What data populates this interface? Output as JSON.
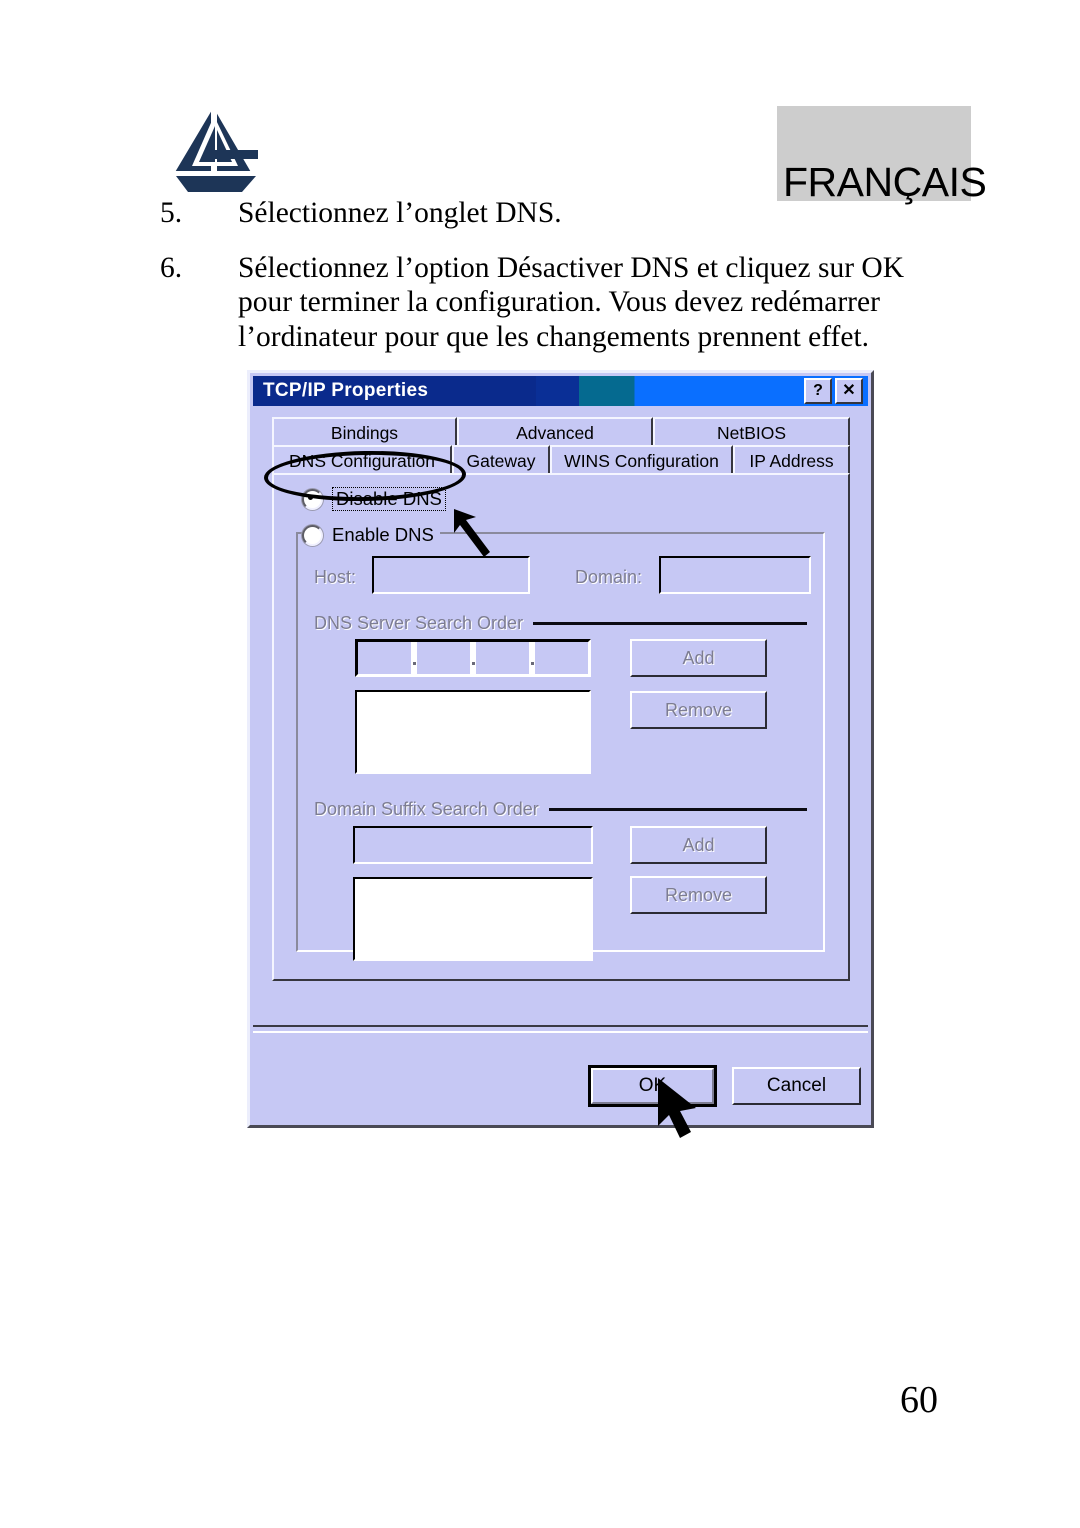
{
  "page": {
    "language_banner": "FRANÇAIS",
    "page_number": "60",
    "logo_name": "atlantis-land-logo"
  },
  "steps": [
    {
      "number": "5.",
      "lines": [
        "Sélectionnez l’onglet  DNS."
      ]
    },
    {
      "number": "6.",
      "lines": [
        "Sélectionnez l’option Désactiver  DNS  et  cliquez  sur  OK",
        "pour  terminer  la  configuration.  Vous  devez  redémarrer",
        "l’ordinateur pour que les changements prennent effet."
      ]
    }
  ],
  "dialog": {
    "title": "TCP/IP Properties",
    "titlebar_buttons": [
      {
        "name": "help-button",
        "glyph": "?"
      },
      {
        "name": "close-button",
        "glyph": "✕"
      }
    ],
    "tabs_row1": [
      "Bindings",
      "Advanced",
      "NetBIOS"
    ],
    "tabs_row2": [
      "DNS Configuration",
      "Gateway",
      "WINS Configuration",
      "IP Address"
    ],
    "selected_tab": "DNS Configuration",
    "radios": [
      {
        "label": "Disable DNS",
        "accel": "i",
        "checked": true,
        "focused": true
      },
      {
        "label": "Enable DNS",
        "accel": "E",
        "checked": false,
        "focused": false
      }
    ],
    "host_label": "Host:",
    "host_value": "",
    "domain_label": "Domain:",
    "domain_value": "",
    "dns_server_section_title": "DNS Server Search Order",
    "dns_server_ip_value": [
      "",
      "",
      "",
      ""
    ],
    "dns_server_list_items": [],
    "dns_server_add_label": "Add",
    "dns_server_remove_label": "Remove",
    "domain_suffix_section_title": "Domain Suffix Search Order",
    "domain_suffix_value": "",
    "domain_suffix_list_items": [],
    "domain_suffix_add_label": "Add",
    "domain_suffix_remove_label": "Remove",
    "ok_label": "OK",
    "cancel_label": "Cancel",
    "colors": {
      "face": "#c6c8f4",
      "titlebar_dark": "#0a2a8c",
      "titlebar_light": "#0a6fff",
      "disabled_text": "#7d7d92"
    }
  },
  "annotations": [
    {
      "name": "tab-highlight-ellipse",
      "target": "DNS Configuration"
    },
    {
      "name": "arrow-to-disable-dns",
      "target": "Disable DNS"
    },
    {
      "name": "cursor-arrow-on-ok",
      "target": "OK"
    }
  ]
}
